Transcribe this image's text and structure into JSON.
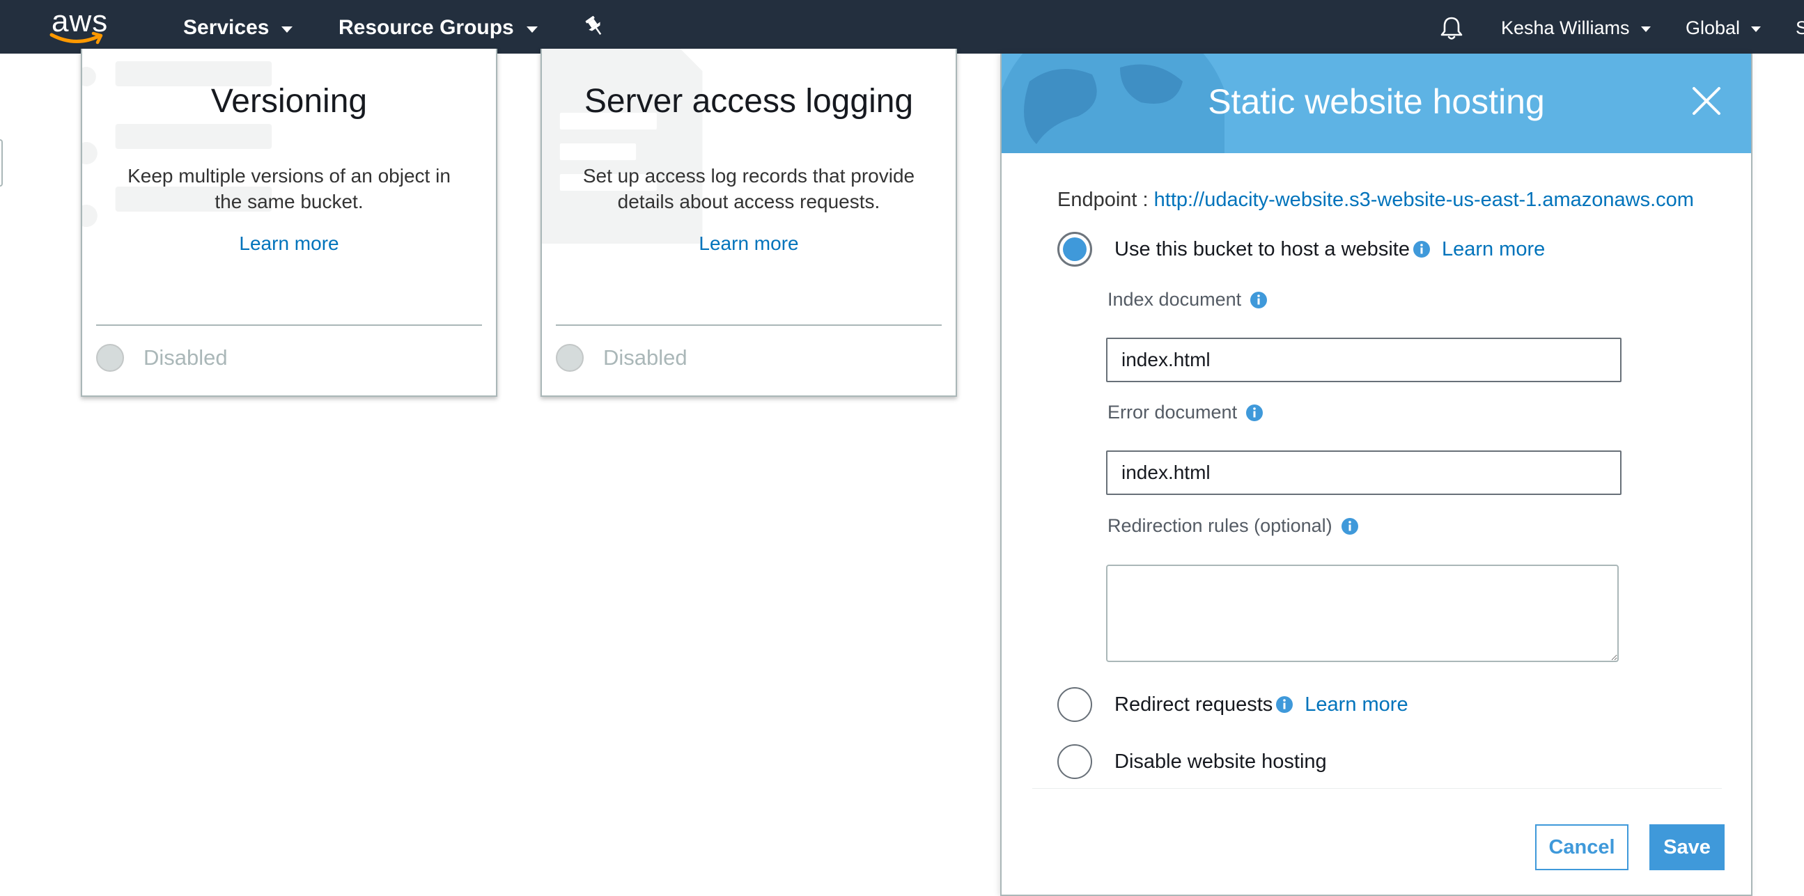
{
  "nav": {
    "logo": "aws",
    "services": "Services",
    "resource_groups": "Resource Groups",
    "user": "Kesha Williams",
    "region": "Global",
    "support": "S"
  },
  "cards": [
    {
      "title": "Versioning",
      "description": "Keep multiple versions of an object in the same bucket.",
      "learn_more": "Learn more",
      "status": "Disabled"
    },
    {
      "title": "Server access logging",
      "description": "Set up access log records that provide details about access requests.",
      "learn_more": "Learn more",
      "status": "Disabled"
    }
  ],
  "panel": {
    "title": "Static website hosting",
    "endpoint_label": "Endpoint : ",
    "endpoint_url": "http://udacity-website.s3-website-us-east-1.amazonaws.com",
    "options": {
      "host": {
        "label": "Use this bucket to host a website",
        "learn_more": "Learn more",
        "selected": true
      },
      "redirect": {
        "label": "Redirect requests",
        "learn_more": "Learn more",
        "selected": false
      },
      "disable": {
        "label": "Disable website hosting",
        "selected": false
      }
    },
    "index_document": {
      "label": "Index document",
      "value": "index.html"
    },
    "error_document": {
      "label": "Error document",
      "value": "index.html"
    },
    "redirection_rules": {
      "label": "Redirection rules (optional)",
      "value": ""
    },
    "cancel": "Cancel",
    "save": "Save"
  },
  "colors": {
    "nav_bg": "#232f3e",
    "panel_header": "#5eb3e4",
    "accent": "#3f99da",
    "link": "#0073bb"
  }
}
